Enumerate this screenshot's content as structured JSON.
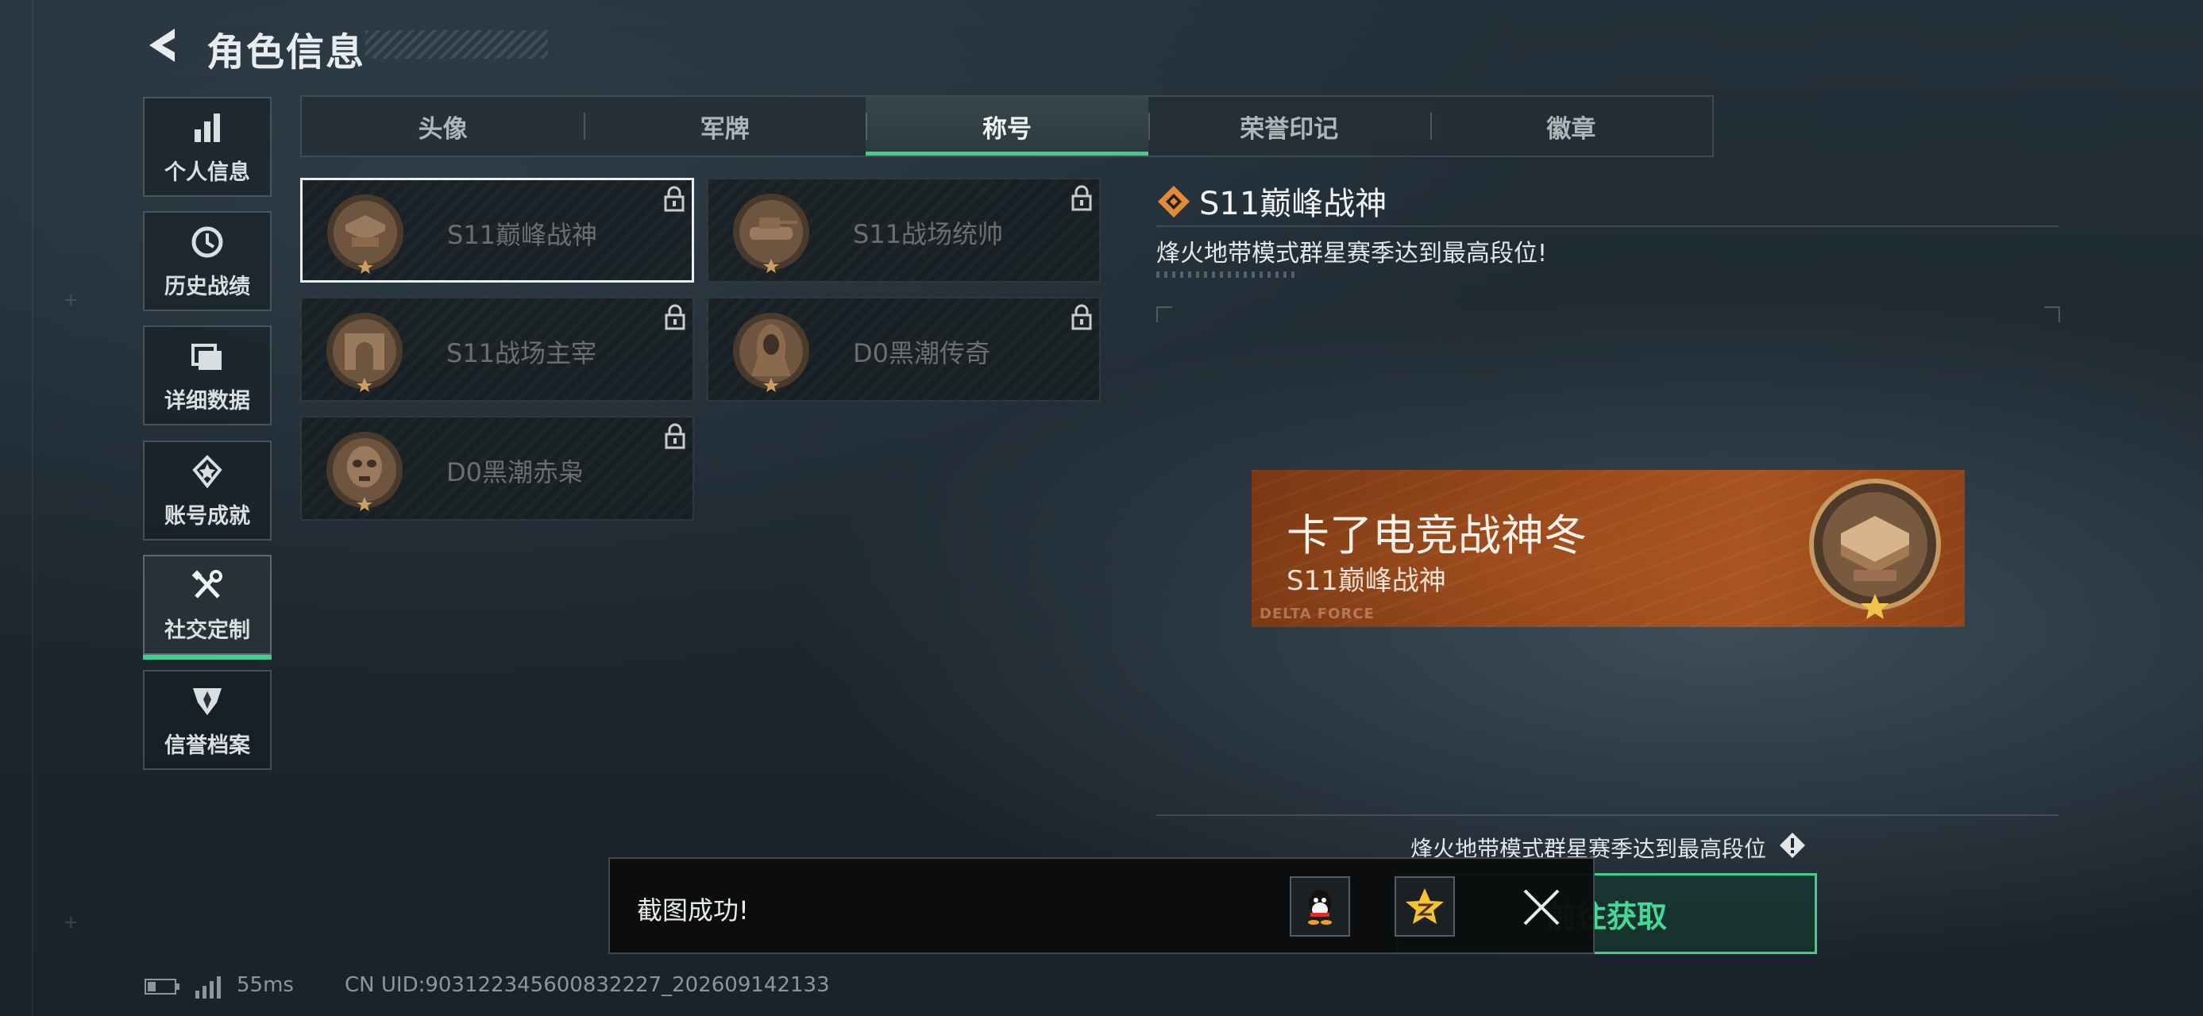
{
  "header": {
    "title": "角色信息"
  },
  "sidebar": {
    "items": [
      {
        "label": "个人信息",
        "icon": "bar-chart-icon",
        "active": false
      },
      {
        "label": "历史战绩",
        "icon": "clock-icon",
        "active": false
      },
      {
        "label": "详细数据",
        "icon": "folder-icon",
        "active": false
      },
      {
        "label": "账号成就",
        "icon": "achievement-star-icon",
        "active": false
      },
      {
        "label": "社交定制",
        "icon": "tools-icon",
        "active": true
      },
      {
        "label": "信誉档案",
        "icon": "shield-wing-icon",
        "active": false
      }
    ]
  },
  "tabs": [
    {
      "label": "头像",
      "active": false
    },
    {
      "label": "军牌",
      "active": false
    },
    {
      "label": "称号",
      "active": true
    },
    {
      "label": "荣誉印记",
      "active": false
    },
    {
      "label": "徽章",
      "active": false
    }
  ],
  "titles": [
    {
      "label": "S11巅峰战神",
      "medal": "trophy-plate-medal",
      "locked": true,
      "selected": true
    },
    {
      "label": "S11战场统帅",
      "medal": "tank-medal",
      "locked": true,
      "selected": false
    },
    {
      "label": "S11战场主宰",
      "medal": "arch-medal",
      "locked": true,
      "selected": false
    },
    {
      "label": "D0黑潮传奇",
      "medal": "hooded-figure-medal",
      "locked": true,
      "selected": false
    },
    {
      "label": "D0黑潮赤枭",
      "medal": "skull-mask-medal",
      "locked": true,
      "selected": false
    }
  ],
  "detail": {
    "title": "S11巅峰战神",
    "description": "烽火地带模式群星赛季达到最高段位!",
    "banner": {
      "player_name": "卡了电竞战神冬",
      "title": "S11巅峰战神",
      "brand": "DELTA FORCE"
    },
    "requirement": "烽火地带模式群星赛季达到最高段位",
    "action_label": "前往获取"
  },
  "toast": {
    "message": "截图成功!",
    "share_targets": [
      "qq-icon",
      "qzone-icon"
    ]
  },
  "status": {
    "ping": "55ms",
    "uid": "CN UID:903122345600832227_202609142133"
  },
  "colors": {
    "accent": "#3ecf8e",
    "banner": "#9a4a1b",
    "medal_bronze": "#8a6a4c"
  }
}
